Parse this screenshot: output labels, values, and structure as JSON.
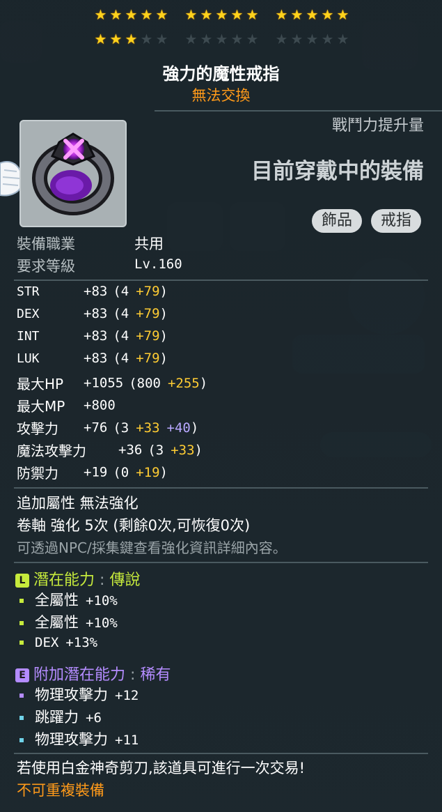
{
  "stars": {
    "row1": [
      [
        true,
        true,
        true,
        true,
        true
      ],
      [
        true,
        true,
        true,
        true,
        true
      ],
      [
        true,
        true,
        true,
        true,
        true
      ]
    ],
    "row2": [
      [
        true,
        true,
        true,
        false,
        false
      ],
      [
        false,
        false,
        false,
        false,
        false
      ],
      [
        false,
        false,
        false,
        false,
        false
      ]
    ]
  },
  "item": {
    "name": "強力的魔性戒指",
    "trade_status": "無法交換",
    "power_label": "戰鬥力提升量",
    "equipped_text": "目前穿戴中的裝備",
    "tags": [
      "飾品",
      "戒指"
    ]
  },
  "requirements": {
    "job_label": "裝備職業",
    "job_value": "共用",
    "level_label": "要求等級",
    "level_value": "Lv.160"
  },
  "stats": [
    {
      "name": "STR",
      "total": "+83",
      "base": "(4",
      "bonus": "+79",
      "extra": "",
      "close": ")"
    },
    {
      "name": "DEX",
      "total": "+83",
      "base": "(4",
      "bonus": "+79",
      "extra": "",
      "close": ")"
    },
    {
      "name": "INT",
      "total": "+83",
      "base": "(4",
      "bonus": "+79",
      "extra": "",
      "close": ")"
    },
    {
      "name": "LUK",
      "total": "+83",
      "base": "(4",
      "bonus": "+79",
      "extra": "",
      "close": ")"
    },
    {
      "name": "最大HP",
      "total": "+1055",
      "base": "(800",
      "bonus": "+255",
      "extra": "",
      "close": ")"
    },
    {
      "name": "最大MP",
      "total": "+800",
      "base": "",
      "bonus": "",
      "extra": "",
      "close": ""
    },
    {
      "name": "攻擊力",
      "total": "+76",
      "base": "(3",
      "bonus": "+33",
      "extra": "+40",
      "close": ")"
    },
    {
      "name": "魔法攻擊力",
      "total": "+36",
      "base": "(3",
      "bonus": "+33",
      "extra": "",
      "close": ")"
    },
    {
      "name": "防禦力",
      "total": "+19",
      "base": "(0",
      "bonus": "+19",
      "extra": "",
      "close": ")"
    }
  ],
  "enhance": {
    "line1": "追加屬性 無法強化",
    "line2": "卷軸 強化 5次 (剩餘0次,可恢復0次)",
    "line3": "可透過NPC/採集鍵查看強化資訊詳細內容。"
  },
  "potential": {
    "grade_letter": "L",
    "title": "潛在能力",
    "sep": ":",
    "grade": "傳說",
    "color": "#c6ea3c",
    "lines": [
      {
        "name": "全屬性",
        "value": "+10%",
        "bullet": "#c6ea3c"
      },
      {
        "name": "全屬性",
        "value": "+10%",
        "bullet": "#c6ea3c"
      },
      {
        "name": "DEX",
        "value": "+13%",
        "bullet": "#c6ea3c"
      }
    ]
  },
  "additional": {
    "grade_letter": "E",
    "title": "附加潛在能力",
    "sep": ":",
    "grade": "稀有",
    "color": "#b48cff",
    "lines": [
      {
        "name": "物理攻擊力",
        "value": "+12",
        "bullet": "#b48cff"
      },
      {
        "name": "跳躍力",
        "value": "+6",
        "bullet": "#6fd2e8"
      },
      {
        "name": "物理攻擊力",
        "value": "+11",
        "bullet": "#6fd2e8"
      }
    ]
  },
  "footer": {
    "trade_note": "若使用白金神奇剪刀,該道具可進行一次交易!",
    "unique_note": "不可重複裝備"
  }
}
